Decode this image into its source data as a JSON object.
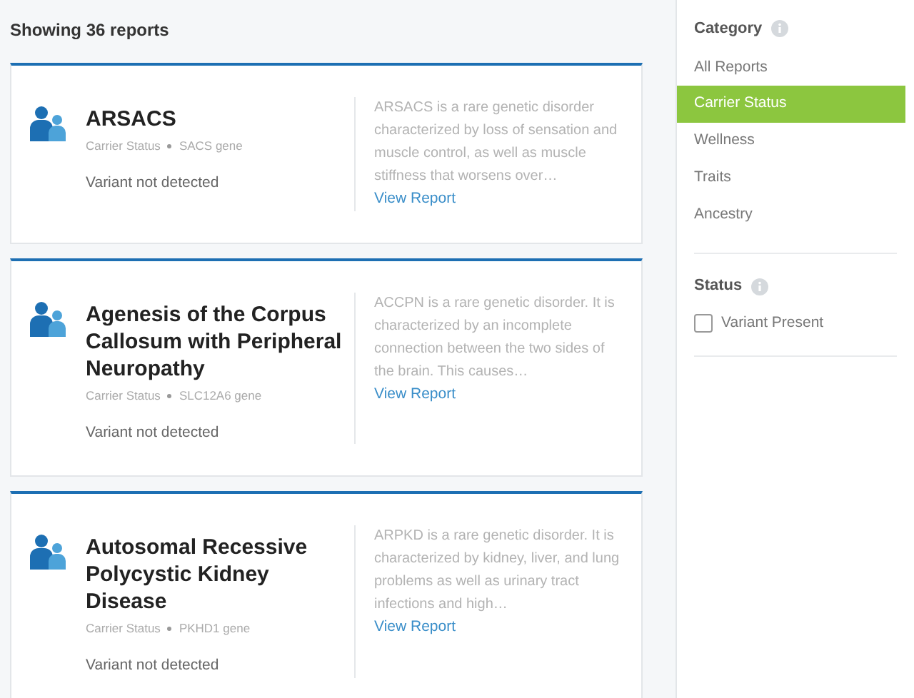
{
  "results_heading": "Showing 36 reports",
  "reports": [
    {
      "title": "ARSACS",
      "category": "Carrier Status",
      "gene": "SACS gene",
      "result": "Variant not detected",
      "description": "ARSACS is a rare genetic disorder characterized by loss of sensation and muscle control, as well as muscle stiffness that worsens over…",
      "link": "View Report"
    },
    {
      "title": "Agenesis of the Corpus Callosum with Peripheral Neuropathy",
      "category": "Carrier Status",
      "gene": "SLC12A6 gene",
      "result": "Variant not detected",
      "description": "ACCPN is a rare genetic disorder. It is characterized by an incomplete connection between the two sides of the brain. This causes…",
      "link": "View Report"
    },
    {
      "title": "Autosomal Recessive Polycystic Kidney Disease",
      "category": "Carrier Status",
      "gene": "PKHD1 gene",
      "result": "Variant not detected",
      "description": "ARPKD is a rare genetic disorder. It is characterized by kidney, liver, and lung problems as well as urinary tract infections and high…",
      "link": "View Report"
    }
  ],
  "sidebar": {
    "category": {
      "heading": "Category",
      "items": [
        {
          "label": "All Reports",
          "selected": false
        },
        {
          "label": "Carrier Status",
          "selected": true
        },
        {
          "label": "Wellness",
          "selected": false
        },
        {
          "label": "Traits",
          "selected": false
        },
        {
          "label": "Ancestry",
          "selected": false
        }
      ]
    },
    "status": {
      "heading": "Status",
      "options": [
        {
          "label": "Variant Present",
          "checked": false
        }
      ]
    }
  }
}
